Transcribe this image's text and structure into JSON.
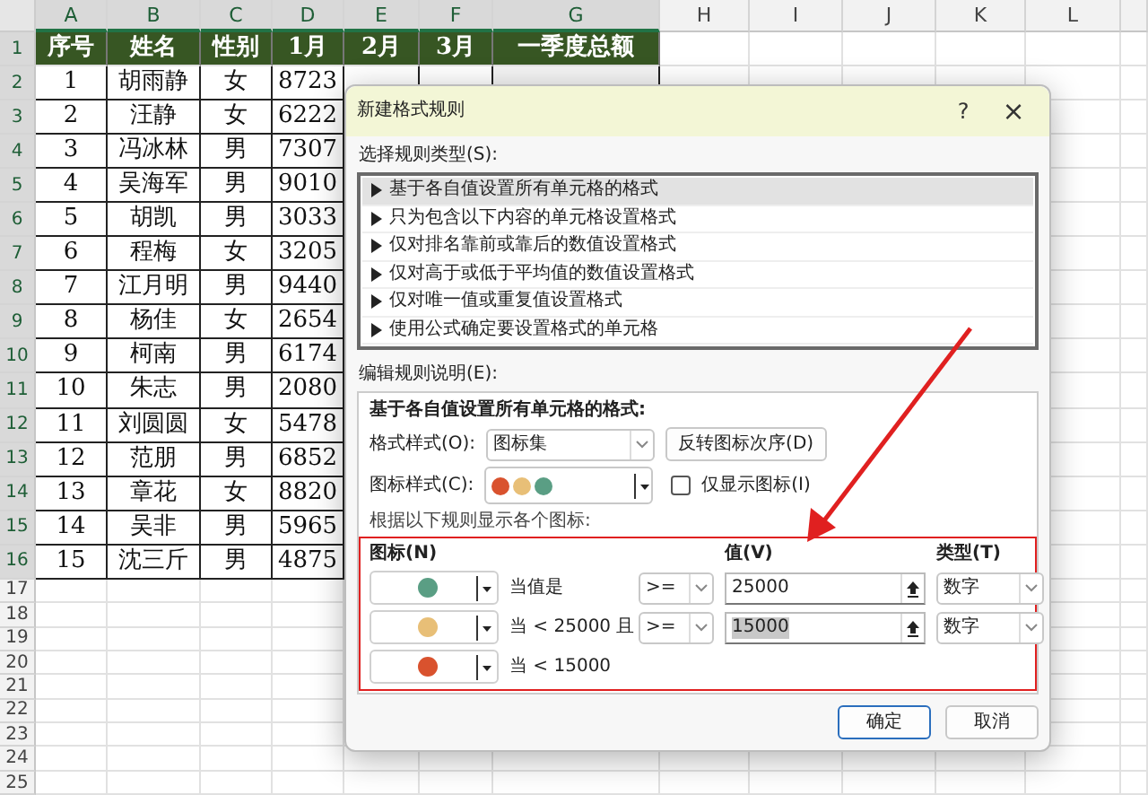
{
  "sheet": {
    "columns": [
      "A",
      "B",
      "C",
      "D",
      "E",
      "F",
      "G",
      "H",
      "I",
      "J",
      "K",
      "L"
    ],
    "row_numbers": [
      "1",
      "2",
      "3",
      "4",
      "5",
      "6",
      "7",
      "8",
      "9",
      "10",
      "11",
      "12",
      "13",
      "14",
      "15",
      "16",
      "17",
      "18",
      "19",
      "20",
      "21",
      "22",
      "23",
      "24",
      "25"
    ],
    "header": [
      "序号",
      "姓名",
      "性别",
      "1月",
      "2月",
      "3月",
      "一季度总额"
    ],
    "rows": [
      {
        "cells": [
          "1",
          "胡雨静",
          "女",
          "8723"
        ]
      },
      {
        "cells": [
          "2",
          "汪静",
          "女",
          "6222"
        ]
      },
      {
        "cells": [
          "3",
          "冯冰林",
          "男",
          "7307"
        ]
      },
      {
        "cells": [
          "4",
          "吴海军",
          "男",
          "9010"
        ]
      },
      {
        "cells": [
          "5",
          "胡凯",
          "男",
          "3033"
        ]
      },
      {
        "cells": [
          "6",
          "程梅",
          "女",
          "3205"
        ]
      },
      {
        "cells": [
          "7",
          "江月明",
          "男",
          "9440"
        ]
      },
      {
        "cells": [
          "8",
          "杨佳",
          "女",
          "2654"
        ]
      },
      {
        "cells": [
          "9",
          "柯南",
          "男",
          "6174"
        ]
      },
      {
        "cells": [
          "10",
          "朱志",
          "男",
          "2080"
        ]
      },
      {
        "cells": [
          "11",
          "刘圆圆",
          "女",
          "5478"
        ]
      },
      {
        "cells": [
          "12",
          "范朋",
          "男",
          "6852"
        ]
      },
      {
        "cells": [
          "13",
          "章花",
          "女",
          "8820"
        ]
      },
      {
        "cells": [
          "14",
          "吴非",
          "男",
          "5965"
        ]
      },
      {
        "cells": [
          "15",
          "沈三斤",
          "男",
          "4875"
        ]
      }
    ]
  },
  "dialog": {
    "title": "新建格式规则",
    "help": "?",
    "close": "×",
    "rule_type_label": "选择规则类型(S):",
    "rule_types": [
      {
        "label": "基于各自值设置所有单元格的格式",
        "selected": true
      },
      {
        "label": "只为包含以下内容的单元格设置格式",
        "selected": false
      },
      {
        "label": "仅对排名靠前或靠后的数值设置格式",
        "selected": false
      },
      {
        "label": "仅对高于或低于平均值的数值设置格式",
        "selected": false
      },
      {
        "label": "仅对唯一值或重复值设置格式",
        "selected": false
      },
      {
        "label": "使用公式确定要设置格式的单元格",
        "selected": false
      }
    ],
    "edit_label": "编辑规则说明(E):",
    "edit_heading": "基于各自值设置所有单元格的格式:",
    "format_style_label": "格式样式(O):",
    "format_style": "图标集",
    "reverse_button": "反转图标次序(D)",
    "icon_style_label": "图标样式(C):",
    "icon_style": [
      {
        "color": "#d9522e"
      },
      {
        "color": "#e8bf77"
      },
      {
        "color": "#5a9e84"
      }
    ],
    "icon_only": {
      "label": "仅显示图标(I)",
      "checked": false
    },
    "rules_label": "根据以下规则显示各个图标:",
    "col_icon": "图标(N)",
    "col_value": "值(V)",
    "col_type": "类型(T)",
    "rules": [
      {
        "color": "#5a9e84",
        "condition": "当值是",
        "operator": ">=",
        "value": "25000",
        "value_selected": false,
        "type": "数字"
      },
      {
        "color": "#e8bf77",
        "condition": "当 < 25000 且",
        "operator": ">=",
        "value": "15000",
        "value_selected": true,
        "type": "数字"
      },
      {
        "color": "#d9522e",
        "condition": "当 < 15000"
      }
    ],
    "buttons": [
      {
        "label": "确定",
        "default": true
      },
      {
        "label": "取消",
        "default": false
      }
    ]
  }
}
